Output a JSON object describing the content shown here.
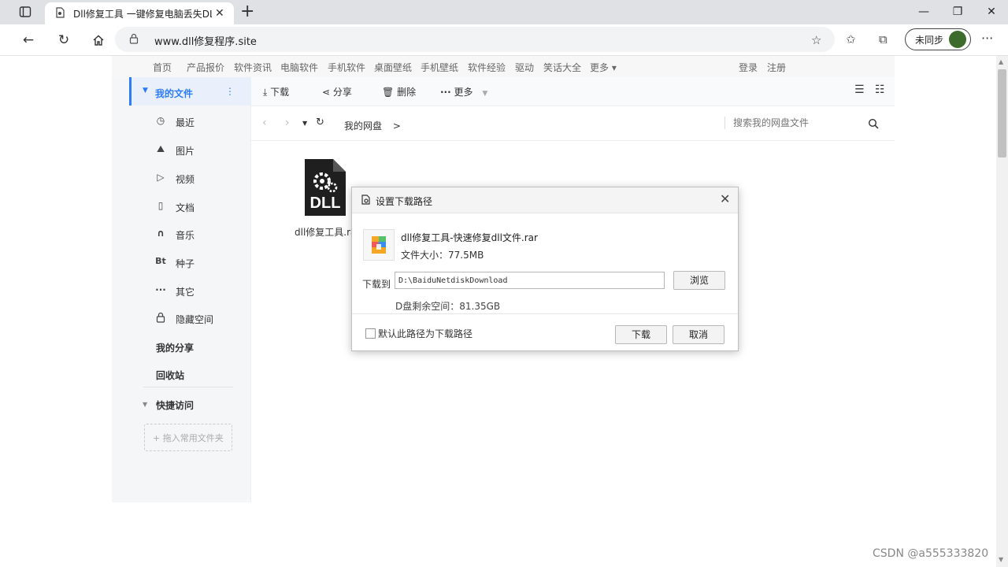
{
  "browser": {
    "tab_title": "Dll修复工具 一键修复电脑丢失DLL",
    "url": "www.dll修复程序.site",
    "sync_label": "未同步"
  },
  "site_nav": {
    "links": [
      "首页",
      "产品报价",
      "软件资讯",
      "电脑软件",
      "手机软件",
      "桌面壁纸",
      "手机壁纸",
      "软件经验",
      "驱动",
      "笑话大全",
      "更多"
    ],
    "more_caret": "▾",
    "login": "登录",
    "register": "注册"
  },
  "sidebar": {
    "my_files": "我的文件",
    "items": [
      {
        "icon": "clock-icon",
        "glyph": "◷",
        "label": "最近"
      },
      {
        "icon": "image-icon",
        "glyph": "⛰",
        "label": "图片"
      },
      {
        "icon": "video-icon",
        "glyph": "▷",
        "label": "视频"
      },
      {
        "icon": "document-icon",
        "glyph": "▯",
        "label": "文档"
      },
      {
        "icon": "headphones-icon",
        "glyph": "∩",
        "label": "音乐"
      },
      {
        "icon": "bt-icon",
        "glyph": "Bt",
        "label": "种子"
      },
      {
        "icon": "more-dots-icon",
        "glyph": "···",
        "label": "其它"
      },
      {
        "icon": "lock-icon",
        "glyph": "🔒",
        "label": "隐藏空间"
      }
    ],
    "my_share": "我的分享",
    "recycle_bin": "回收站",
    "quick_access": "快捷访问",
    "add_folder": "+ 拖入常用文件夹"
  },
  "toolbar": {
    "download": "下载",
    "share": "分享",
    "delete": "删除",
    "more": "更多"
  },
  "breadcrumb": {
    "root": "我的网盘",
    "sep": ">",
    "search_placeholder": "搜索我的网盘文件"
  },
  "file": {
    "icon_text": "DLL",
    "name": "dll修复工具.rar"
  },
  "dialog": {
    "title": "设置下载路径",
    "filename": "dll修复工具-快速修复dll文件.rar",
    "size_label": "文件大小：77.5MB",
    "download_to": "下载到",
    "path": "D:\\BaiduNetdiskDownload",
    "browse": "浏览",
    "free_space": "D盘剩余空间：81.35GB",
    "default_path_label": "默认此路径为下载路径",
    "confirm": "下载",
    "cancel": "取消"
  },
  "watermark": "CSDN @a555333820",
  "colors": {
    "accent": "#2d7cf6",
    "sidebar_active_bg": "#e9f0fb",
    "rar_orange": "#f5a623",
    "rar_green": "#55c26a",
    "rar_blue": "#3b8ef0",
    "rar_red": "#ef5a5a"
  }
}
